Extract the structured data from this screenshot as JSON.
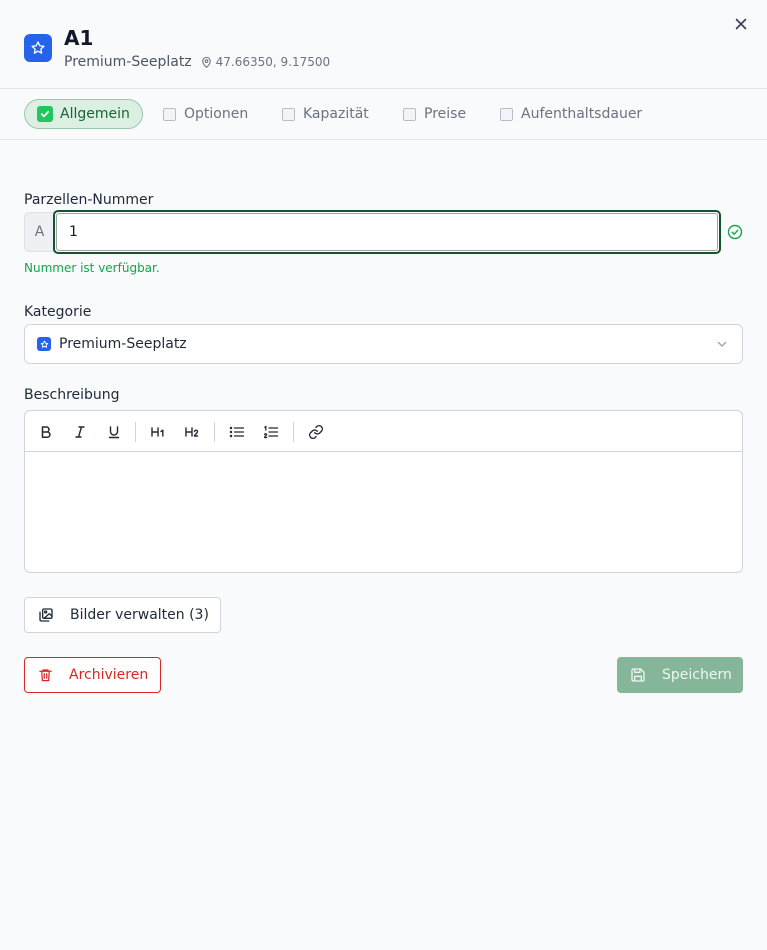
{
  "header": {
    "title": "A1",
    "category": "Premium-Seeplatz",
    "coordinates": "47.66350, 9.17500",
    "icons": [
      "star-icon",
      "map-pin-icon",
      "close-icon"
    ]
  },
  "tabs": [
    {
      "label": "Allgemein",
      "state": "done",
      "active": true
    },
    {
      "label": "Optionen",
      "state": "pending",
      "active": false
    },
    {
      "label": "Kapazität",
      "state": "pending",
      "active": false
    },
    {
      "label": "Preise",
      "state": "pending",
      "active": false
    },
    {
      "label": "Aufenthaltsdauer",
      "state": "pending",
      "active": false
    }
  ],
  "form": {
    "number_label": "Parzellen-Nummer",
    "number_prefix": "A",
    "number_value": "1",
    "number_help": "Nummer ist verfügbar.",
    "category_label": "Kategorie",
    "category_value": "Premium-Seeplatz",
    "description_label": "Beschreibung",
    "description_value": ""
  },
  "editor_toolbar": [
    "bold",
    "italic",
    "underline",
    "heading-1",
    "heading-2",
    "bullet-list",
    "ordered-list",
    "link"
  ],
  "buttons": {
    "images": "Bilder verwalten (3)",
    "archive": "Archivieren",
    "save": "Speichern"
  },
  "colors": {
    "accent": "#2563eb",
    "success": "#16a34a",
    "danger": "#dc2626",
    "save_disabled": "#86b69a"
  }
}
